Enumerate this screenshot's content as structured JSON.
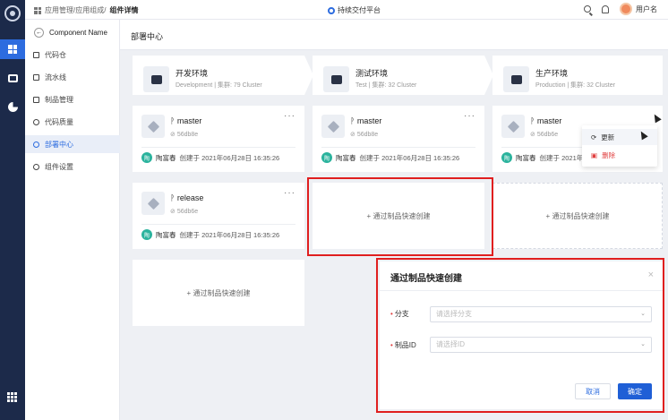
{
  "header": {
    "breadcrumb_prefix": "应用管理/应用组成/",
    "breadcrumb_current": "组件详情",
    "platform": "持续交付平台",
    "user": "用户名"
  },
  "sidebar": {
    "component_name": "Component Name",
    "items": [
      {
        "label": "代码仓"
      },
      {
        "label": "流水线"
      },
      {
        "label": "制品管理"
      },
      {
        "label": "代码质量"
      },
      {
        "label": "部署中心"
      },
      {
        "label": "组件设置"
      }
    ]
  },
  "page": {
    "title": "部署中心"
  },
  "environments": [
    {
      "name": "开发环境",
      "meta": "Development | 集群: 79 Cluster"
    },
    {
      "name": "测试环境",
      "meta": "Test | 集群: 32 Cluster"
    },
    {
      "name": "生产环境",
      "meta": "Production | 集群: 32 Cluster"
    }
  ],
  "versions": [
    {
      "name": "master",
      "hash": "56db8e",
      "creator": "陶富春",
      "avatar": "陶",
      "created": "创建于 2021年06月28日 16:35:26",
      "more": "···"
    },
    {
      "name": "master",
      "hash": "56db8e",
      "creator": "陶富春",
      "avatar": "陶",
      "created": "创建于 2021年06月28日 16:35:26",
      "more": "···"
    },
    {
      "name": "master",
      "hash": "56db6e",
      "creator": "陶富春",
      "avatar": "陶",
      "created": "创建于 2021年06月28日 16:35:26"
    },
    {
      "name": "release",
      "hash": "56db6e",
      "creator": "陶富春",
      "avatar": "陶",
      "created": "创建于 2021年06月28日 16:35:26",
      "more": "···"
    }
  ],
  "quick_create": {
    "a": "+ 通过制品快速创建",
    "b": "+ 通过制品快速创建",
    "c": "+ 通过制品快速创建"
  },
  "context_menu": {
    "update": "更新",
    "delete": "删除"
  },
  "dialog": {
    "title": "通过制品快速创建",
    "close": "×",
    "branch_label": "分支",
    "branch_placeholder": "请选择分支",
    "artifact_label": "制品ID",
    "artifact_placeholder": "请选择ID",
    "cancel": "取消",
    "confirm": "确定"
  },
  "colors": {
    "primary": "#2d6cdf",
    "highlight": "#e01f1f",
    "rail": "#1c2a4a",
    "avatar": "#2bb39d"
  }
}
